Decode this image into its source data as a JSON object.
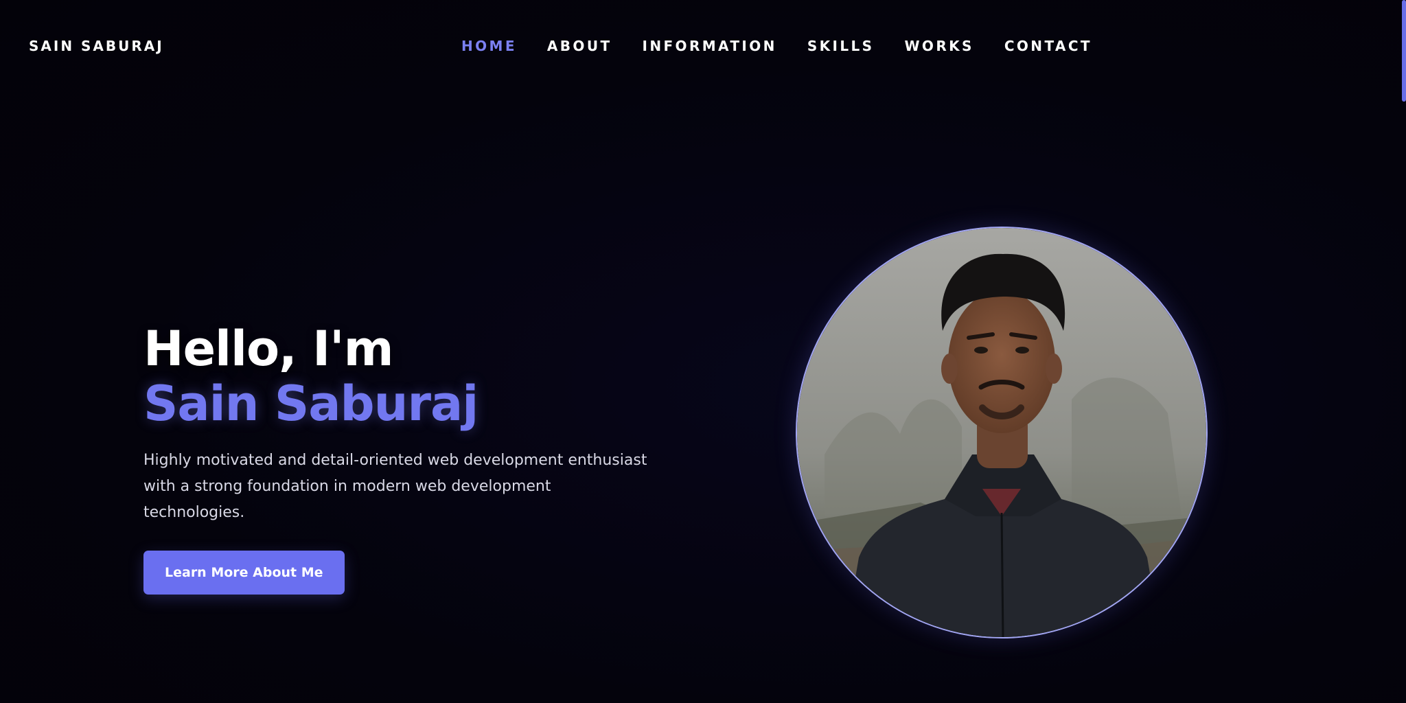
{
  "brand": "SAIN SABURAJ",
  "nav": {
    "items": [
      {
        "label": "HOME",
        "active": true
      },
      {
        "label": "ABOUT",
        "active": false
      },
      {
        "label": "INFORMATION",
        "active": false
      },
      {
        "label": "SKILLS",
        "active": false
      },
      {
        "label": "WORKS",
        "active": false
      },
      {
        "label": "CONTACT",
        "active": false
      }
    ]
  },
  "hero": {
    "greeting": "Hello, I'm",
    "name": "Sain Saburaj",
    "tagline_line1": "Highly motivated and detail-oriented web development enthusiast",
    "tagline_line2": "with a strong foundation in modern web development technologies.",
    "cta_label": "Learn More About Me"
  },
  "colors": {
    "background": "#04030c",
    "accent": "#6a6ff0",
    "accent_text": "#7b80f0",
    "portrait_border": "#a2a6f4"
  },
  "icons": {
    "portrait": "profile-photo"
  }
}
